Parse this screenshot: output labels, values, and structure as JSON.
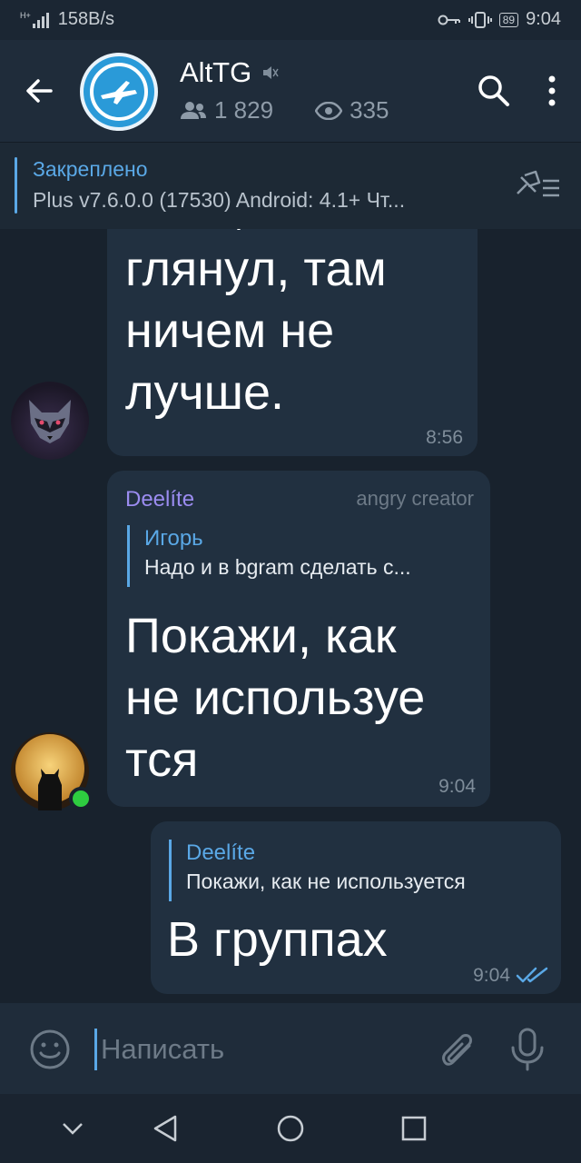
{
  "statusbar": {
    "network": "H+",
    "speed": "158B/s",
    "battery": "89",
    "time": "9:04"
  },
  "header": {
    "title": "AltTG",
    "members": "1 829",
    "views": "335",
    "icons": [
      "back-arrow-icon",
      "channel-logo",
      "muted-icon",
      "members-icon",
      "eye-icon",
      "search-icon",
      "more-vertical-icon"
    ]
  },
  "pinned": {
    "label": "Закреплено",
    "text": "Plus v7.6.0.0 (17530) Android: 4.1+ Чт..."
  },
  "messages": [
    {
      "lines": [
        "Хотя, сейчас",
        "глянул, там",
        "ничем не",
        "лучше."
      ],
      "time": "8:56"
    },
    {
      "sender": "Deelíte",
      "badge": "angry creator",
      "reply_name": "Игорь",
      "reply_text": "Надо и в bgram сделать с...",
      "lines": [
        "Покажи, как",
        "не используе",
        "тся"
      ],
      "time": "9:04"
    },
    {
      "reply_name": "Deelíte",
      "reply_text": "Покажи, как не используется",
      "lines": [
        "В группах"
      ],
      "time": "9:04"
    }
  ],
  "input": {
    "placeholder": "Написать"
  },
  "colors": {
    "accent": "#5aa8e6",
    "bubble": "#213040",
    "background": "#18222d",
    "sender": "#9b8cf0",
    "online": "#2ecc40"
  }
}
